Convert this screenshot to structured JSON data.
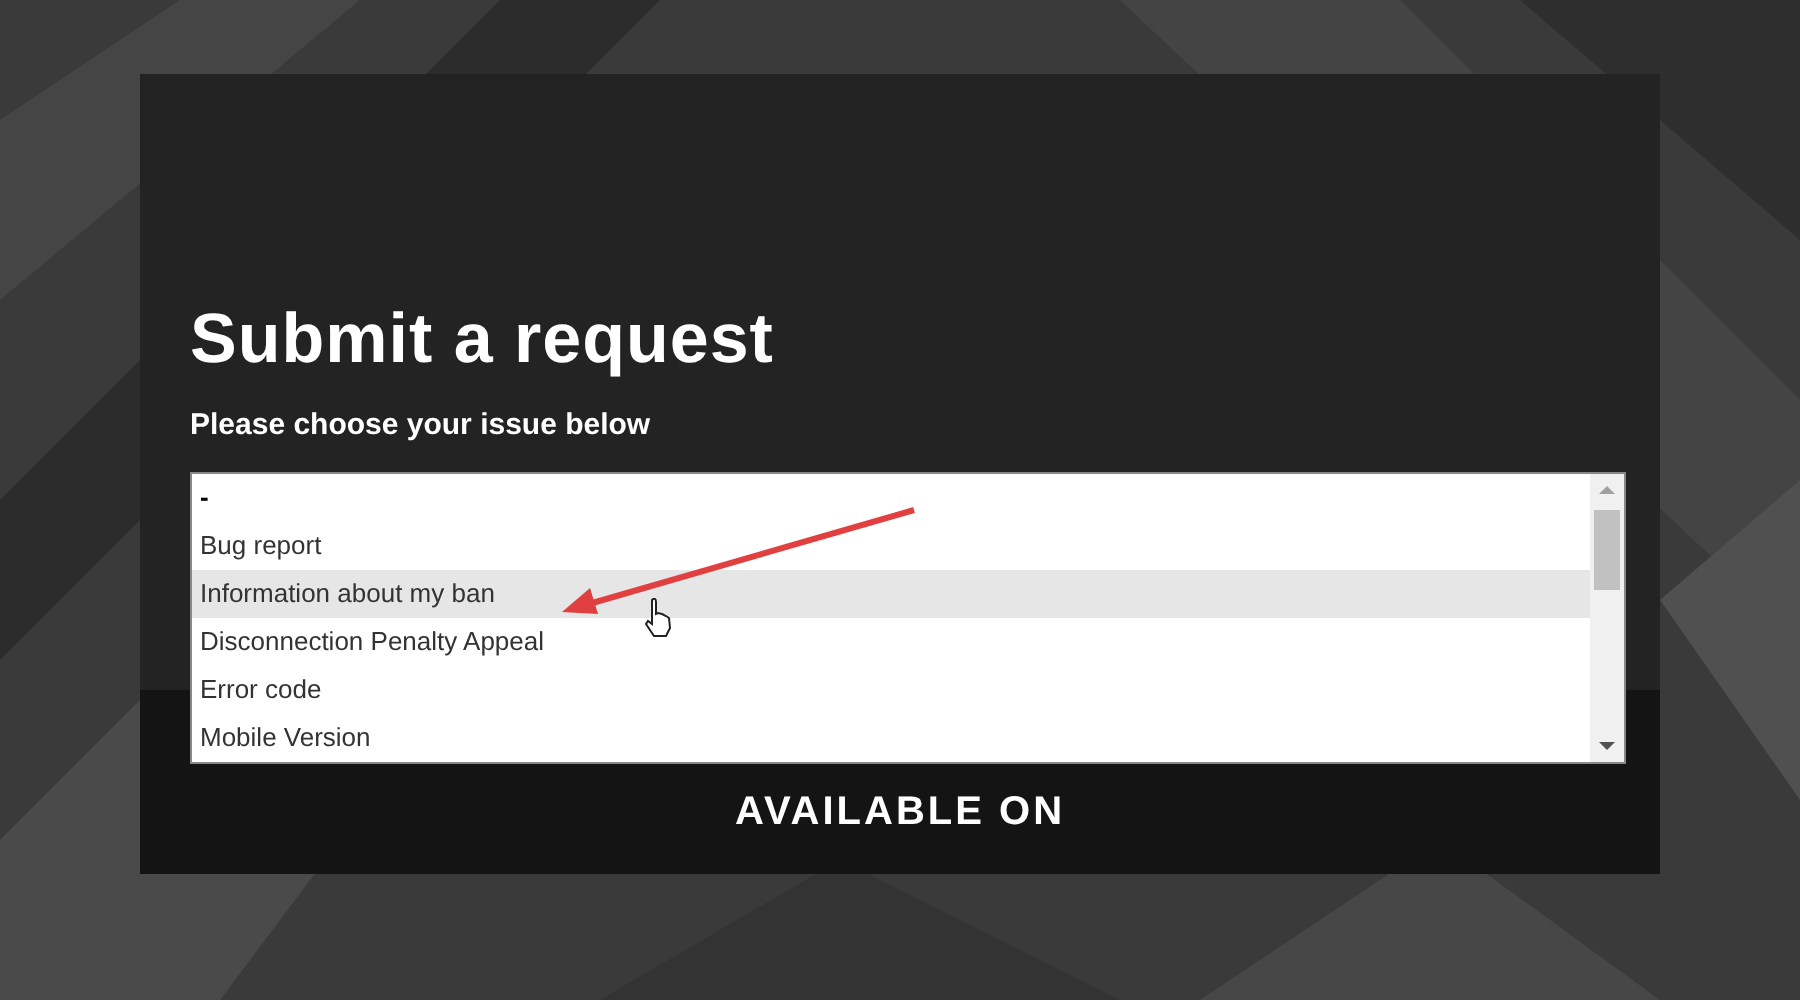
{
  "title": "Submit a request",
  "issue_label": "Please choose your issue below",
  "issue_list": {
    "options": [
      {
        "label": "-",
        "highlighted": false
      },
      {
        "label": "Bug report",
        "highlighted": false
      },
      {
        "label": "Information about my ban",
        "highlighted": true
      },
      {
        "label": "Disconnection Penalty Appeal",
        "highlighted": false
      },
      {
        "label": "Error code",
        "highlighted": false
      },
      {
        "label": "Mobile Version",
        "highlighted": false
      }
    ]
  },
  "footer_heading": "AVAILABLE ON"
}
